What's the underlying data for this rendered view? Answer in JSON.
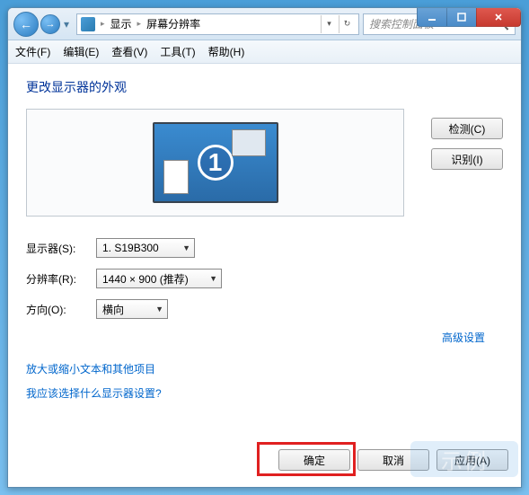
{
  "breadcrumb": {
    "item1": "显示",
    "item2": "屏幕分辨率"
  },
  "search": {
    "placeholder": "搜索控制面板"
  },
  "menu": {
    "file": "文件(F)",
    "edit": "编辑(E)",
    "view": "查看(V)",
    "tools": "工具(T)",
    "help": "帮助(H)"
  },
  "heading": "更改显示器的外观",
  "monitor_number": "1",
  "buttons": {
    "detect": "检测(C)",
    "identify": "识别(I)",
    "ok": "确定",
    "cancel": "取消",
    "apply": "应用(A)"
  },
  "form": {
    "display_label": "显示器(S):",
    "display_value": "1. S19B300",
    "resolution_label": "分辨率(R):",
    "resolution_value": "1440 × 900 (推荐)",
    "orientation_label": "方向(O):",
    "orientation_value": "横向"
  },
  "links": {
    "advanced": "高级设置",
    "textsize": "放大或缩小文本和其他项目",
    "which_display": "我应该选择什么显示器设置?"
  }
}
